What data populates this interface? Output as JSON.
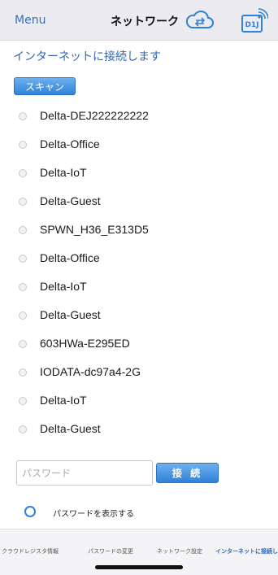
{
  "header": {
    "menu_label": "Menu",
    "title": "ネットワーク",
    "cloud_icon": "cloud-sync-icon",
    "device_icon": "device-wifi-icon",
    "device_label": "D1J"
  },
  "subtitle": "インターネットに接続します",
  "scan_label": "スキャン",
  "networks": [
    "Delta-DEJ222222222",
    "Delta-Office",
    "Delta-IoT",
    "Delta-Guest",
    "SPWN_H36_E313D5",
    "Delta-Office",
    "Delta-IoT",
    "Delta-Guest",
    "603HWa-E295ED",
    "IODATA-dc97a4-2G",
    "Delta-IoT",
    "Delta-Guest"
  ],
  "password": {
    "placeholder": "パスワード",
    "value": "",
    "connect_label": "接 続",
    "show_label": "パスワードを表示する"
  },
  "tabs": [
    {
      "label": "クラウドレジスタ情報",
      "active": false
    },
    {
      "label": "パスワードの変更",
      "active": false
    },
    {
      "label": "ネットワーク設定",
      "active": false
    },
    {
      "label": "インターネットに接続し",
      "active": true
    }
  ],
  "colors": {
    "accent": "#2f82d8",
    "link": "#3a6fb5"
  }
}
